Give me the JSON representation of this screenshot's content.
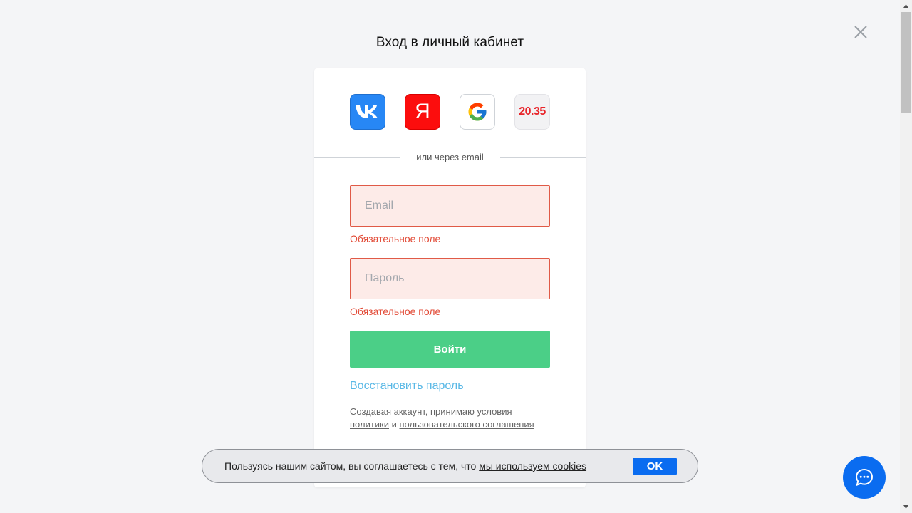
{
  "page": {
    "title": "Вход в личный кабинет"
  },
  "socials": [
    {
      "name": "vk",
      "icon": "vk-icon",
      "color": "#2787f5"
    },
    {
      "name": "yandex",
      "icon": "yandex-icon",
      "label": "Я",
      "color": "#fc0d0d"
    },
    {
      "name": "google",
      "icon": "google-icon"
    },
    {
      "name": "20.35",
      "icon": "platform-2035-icon",
      "label": "20.35",
      "color": "#e8242a"
    }
  ],
  "divider": {
    "text": "или через email"
  },
  "form": {
    "email": {
      "placeholder": "Email",
      "value": "",
      "error": "Обязательное поле"
    },
    "password": {
      "placeholder": "Пароль",
      "value": "",
      "error": "Обязательное поле"
    },
    "submit_label": "Войти",
    "restore_label": "Восстановить пароль",
    "terms": {
      "prefix": "Создавая аккаунт, принимаю условия",
      "policy_link": "политики",
      "conjunction": "и",
      "agreement_link": "пользовательского соглашения"
    }
  },
  "cookie_banner": {
    "text": "Пользуясь нашим сайтом, вы соглашаетесь с тем, что",
    "link": "мы используем cookies",
    "ok_label": "OK"
  },
  "colors": {
    "accent_green": "#4bcf87",
    "error_red": "#e24a36",
    "link_blue": "#59b8e6",
    "primary_blue": "#0a6cf0"
  }
}
